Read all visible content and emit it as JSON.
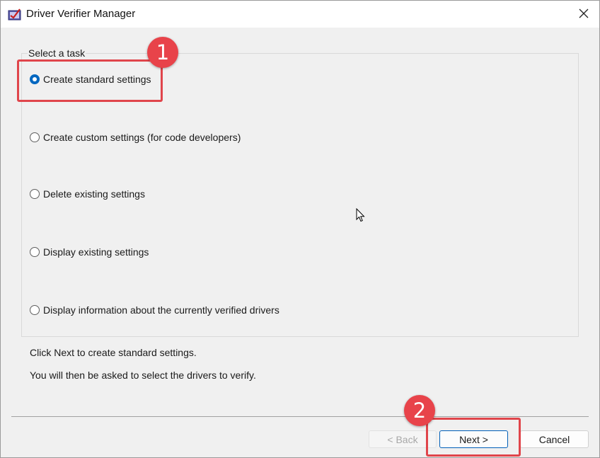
{
  "window": {
    "title": "Driver Verifier Manager",
    "icon": "driver-verifier-app-icon",
    "close_icon": "close-icon"
  },
  "task_group": {
    "label": "Select a task",
    "options": [
      {
        "label": "Create standard settings",
        "checked": true
      },
      {
        "label": "Create custom settings (for code developers)",
        "checked": false
      },
      {
        "label": "Delete existing settings",
        "checked": false
      },
      {
        "label": "Display existing settings",
        "checked": false
      },
      {
        "label": "Display information about the currently verified drivers",
        "checked": false
      }
    ]
  },
  "info": {
    "line1": "Click Next to create standard settings.",
    "line2": "You will then be asked to select the drivers to verify."
  },
  "buttons": {
    "back": "< Back",
    "next": "Next >",
    "cancel": "Cancel"
  },
  "annotations": {
    "badge1": "1",
    "badge2": "2",
    "color": "#e8434a"
  },
  "colors": {
    "accent": "#0067c0",
    "annotation": "#e0454b"
  }
}
